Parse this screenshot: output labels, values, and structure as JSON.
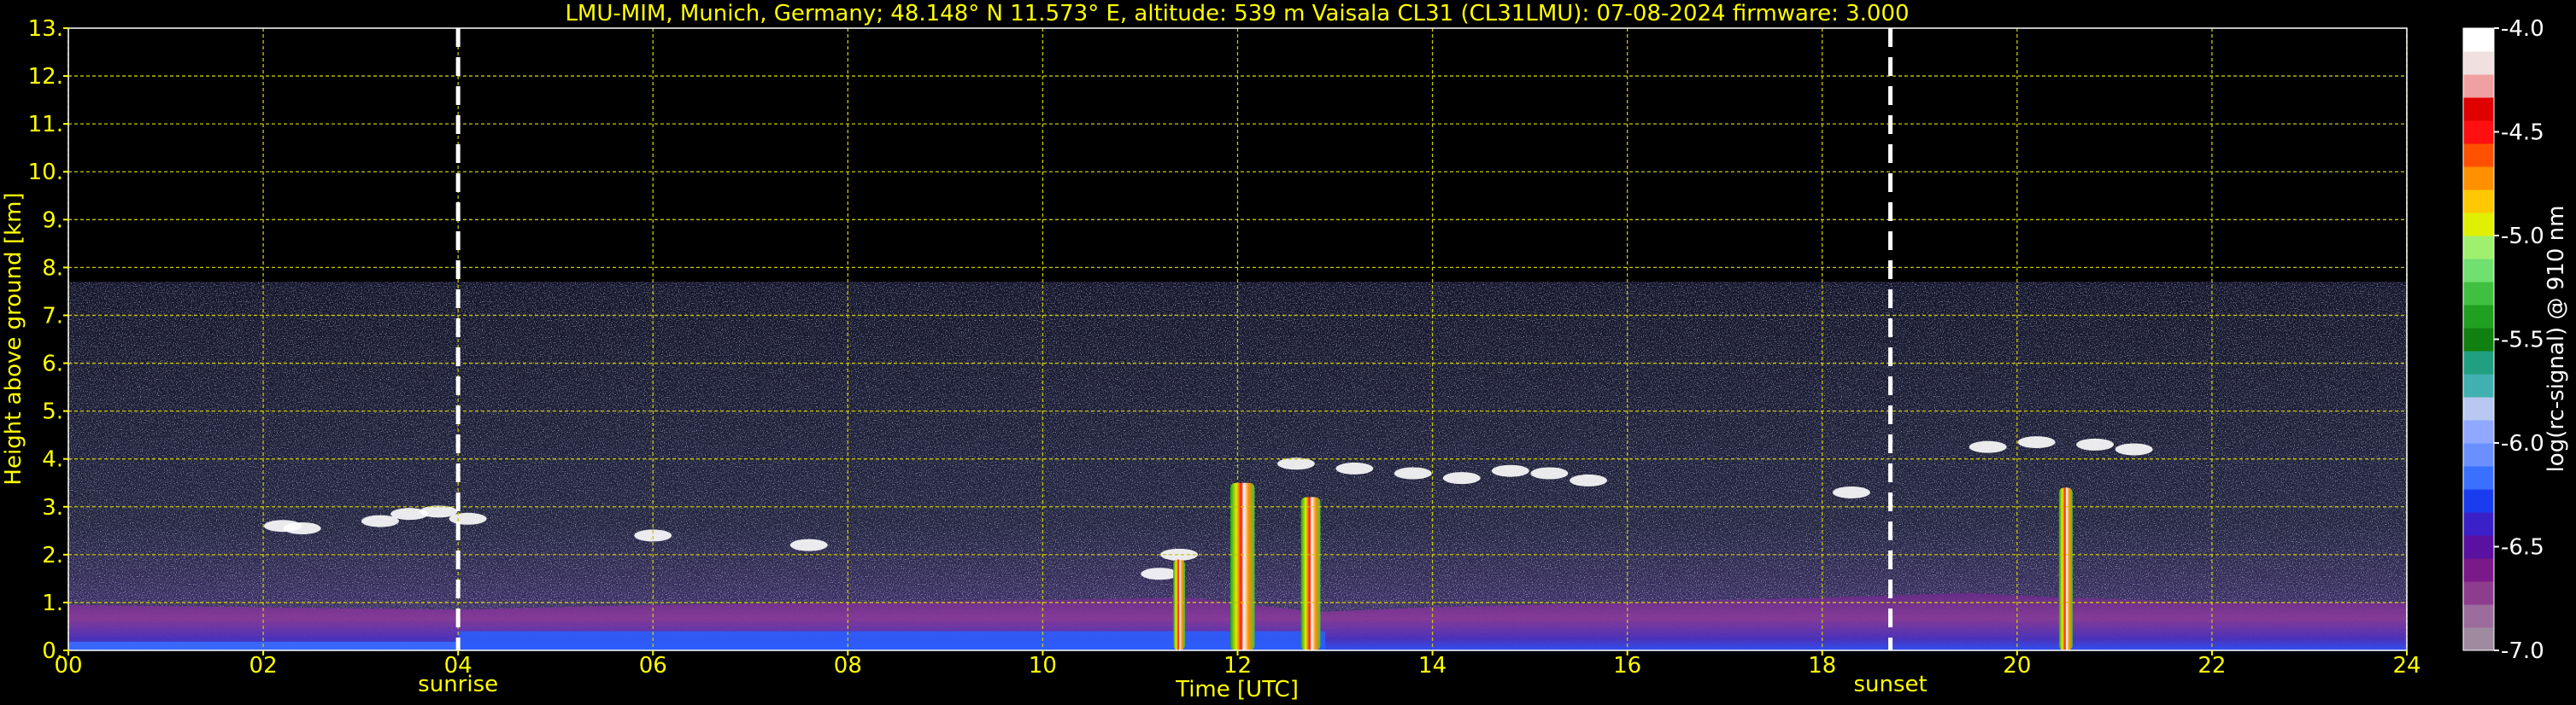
{
  "header": {
    "title": "LMU-MIM, Munich, Germany; 48.148° N 11.573° E, altitude: 539 m    Vaisala CL31 (CL31LMU): 07-08-2024    firmware: 3.000"
  },
  "chart_data": {
    "type": "heatmap",
    "title": "LMU-MIM, Munich, Germany; 48.148° N 11.573° E, altitude: 539 m    Vaisala CL31 (CL31LMU): 07-08-2024    firmware: 3.000",
    "xlabel": "Time [UTC]",
    "ylabel": "Height above ground [km]",
    "xlim": [
      0,
      24
    ],
    "ylim": [
      0,
      13
    ],
    "x_ticks": [
      "00",
      "02",
      "04",
      "06",
      "08",
      "10",
      "12",
      "14",
      "16",
      "18",
      "20",
      "22",
      "24"
    ],
    "y_ticks": [
      "0.",
      "1.",
      "2.",
      "3.",
      "4.",
      "5.",
      "6.",
      "7.",
      "8.",
      "9.",
      "10.",
      "11.",
      "12.",
      "13."
    ],
    "grid": true,
    "signal_top_km": 7.7,
    "markers": [
      {
        "label": "sunrise",
        "time": 4.0
      },
      {
        "label": "sunset",
        "time": 18.7
      }
    ],
    "colorbar": {
      "label": "log(rc-signal) @ 910 nm",
      "range": [
        -7.0,
        -4.0
      ],
      "ticks": [
        "-4.0",
        "-4.5",
        "-5.0",
        "-5.5",
        "-6.0",
        "-6.5",
        "-7.0"
      ],
      "colors": [
        "#a08aa0",
        "#9c6c9c",
        "#8e3c8e",
        "#7a1a8a",
        "#5a10a0",
        "#3a20c8",
        "#1a3cf0",
        "#3a70ff",
        "#6a90ff",
        "#90a8ff",
        "#b8c8f0",
        "#40b0b0",
        "#20a080",
        "#108010",
        "#20a020",
        "#40c040",
        "#70e070",
        "#a0f070",
        "#e0f000",
        "#ffc800",
        "#ff9000",
        "#ff5000",
        "#ff1010",
        "#e00000",
        "#f0a0a0",
        "#f0e0e0",
        "#ffffff"
      ]
    }
  }
}
